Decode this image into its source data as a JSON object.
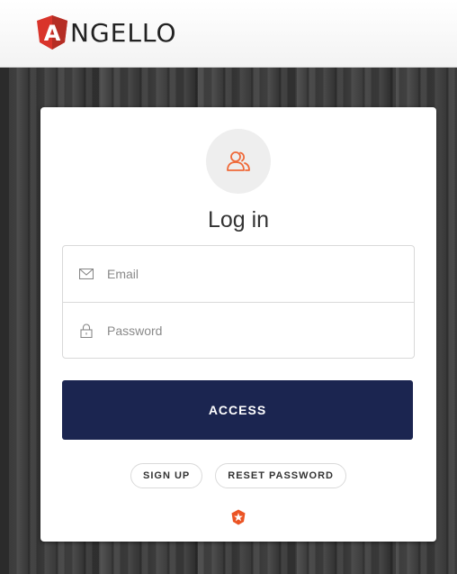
{
  "brand": {
    "logo_letter": "A",
    "name": "NGELLO"
  },
  "login": {
    "title": "Log in",
    "email_placeholder": "Email",
    "password_placeholder": "Password",
    "access_label": "ACCESS",
    "signup_label": "SIGN UP",
    "reset_label": "RESET PASSWORD"
  },
  "colors": {
    "accent": "#ef6a3a",
    "button": "#1b2550",
    "logo_shield": "#d9342b"
  },
  "icons": [
    "users-icon",
    "mail-icon",
    "lock-icon",
    "auth0-badge-icon"
  ]
}
